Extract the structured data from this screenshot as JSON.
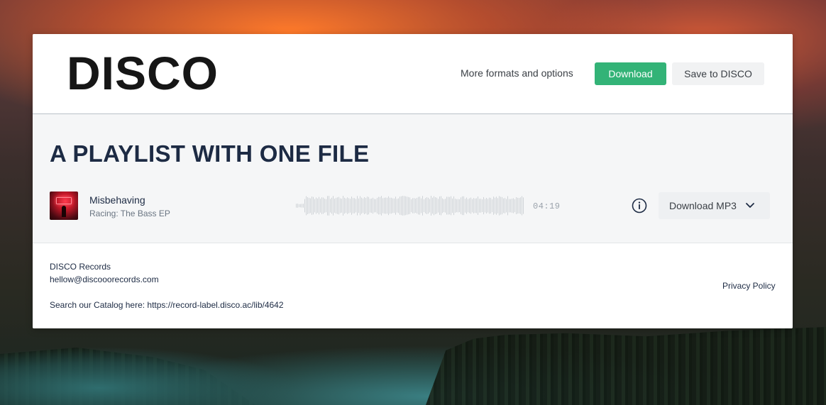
{
  "header": {
    "logo_text": "DISCO",
    "more_link": "More formats and options",
    "download_label": "Download",
    "save_label": "Save to DISCO"
  },
  "playlist": {
    "title": "A PLAYLIST WITH ONE FILE",
    "tracks": [
      {
        "title": "Misbehaving",
        "subtitle": "Racing: The Bass EP",
        "duration": "04:19",
        "download_label": "Download MP3",
        "info_icon": "info-icon",
        "menu_icon": "chevron-down-icon"
      }
    ]
  },
  "footer": {
    "label_name": "DISCO Records",
    "email": "hellow@discooorecords.com",
    "catalog": "Search our Catalog here: https://record-label.disco.ac/lib/4642",
    "privacy": "Privacy Policy"
  },
  "colors": {
    "accent": "#33b377",
    "title": "#1d2b44",
    "waveform": "#cfd3d7"
  }
}
